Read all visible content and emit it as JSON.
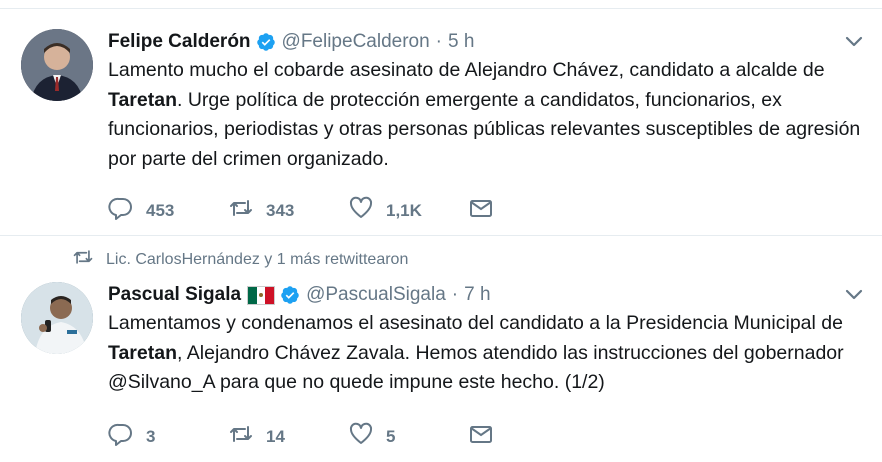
{
  "tweets": [
    {
      "author": "Felipe Calderón",
      "handle": "@FelipeCalderon",
      "separator": "·",
      "time": "5 h",
      "text_parts": {
        "p1": "Lamento mucho el cobarde asesinato de Alejandro Chávez, candidato a alcalde de ",
        "bold": "Taretan",
        "p2": ". Urge política de protección emergente a candidatos, funcionarios, ex funcionarios, periodistas y otras personas públicas relevantes susceptibles de agresión por parte del crimen organizado."
      },
      "replies": "453",
      "retweets": "343",
      "likes": "1,1K"
    },
    {
      "retweet_context": "Lic. CarlosHernández y 1 más retwittearon",
      "author": "Pascual Sigala",
      "handle": "@PascualSigala",
      "separator": "·",
      "time": "7 h",
      "text_parts": {
        "p1": "Lamentamos y condenamos el asesinato del candidato a la Presidencia Municipal de ",
        "bold": "Taretan",
        "p2": ", Alejandro Chávez Zavala. Hemos atendido las instrucciones del gobernador @Silvano_A para que no quede impune este hecho. (1/2)"
      },
      "replies": "3",
      "retweets": "14",
      "likes": "5"
    }
  ],
  "colors": {
    "text": "#14171a",
    "secondary": "#657786",
    "verified": "#1da1f2",
    "divider": "#e6ecf0"
  },
  "icons": {
    "reply": "reply-icon",
    "retweet": "retweet-icon",
    "like": "heart-icon",
    "message": "envelope-icon",
    "menu": "chevron-down-icon",
    "verified": "verified-badge-icon",
    "flag": "mexico-flag-icon"
  }
}
